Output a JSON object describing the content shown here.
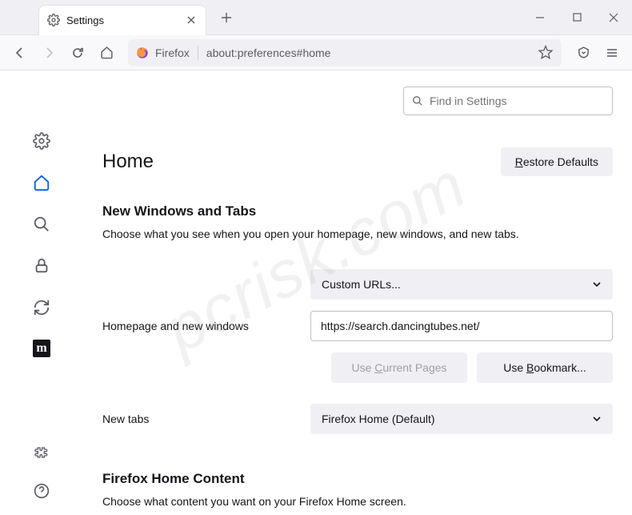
{
  "window": {
    "tab_title": "Settings"
  },
  "toolbar": {
    "brand": "Firefox",
    "url": "about:preferences#home"
  },
  "search_placeholder": "Find in Settings",
  "page_title": "Home",
  "restore_btn": "estore Defaults",
  "section1": {
    "heading": "New Windows and Tabs",
    "desc": "Choose what you see when you open your homepage, new windows, and new tabs."
  },
  "homepage": {
    "label": "Homepage and new windows",
    "dropdown": "Custom URLs...",
    "url_value": "https://search.dancingtubes.net/",
    "use_current": "urrent Pages",
    "use_bookmark": "ookmark..."
  },
  "newtabs": {
    "label": "New tabs",
    "dropdown": "Firefox Home (Default)"
  },
  "section2": {
    "heading": "Firefox Home Content",
    "desc": "Choose what content you want on your Firefox Home screen."
  },
  "sidebar_m": "m"
}
